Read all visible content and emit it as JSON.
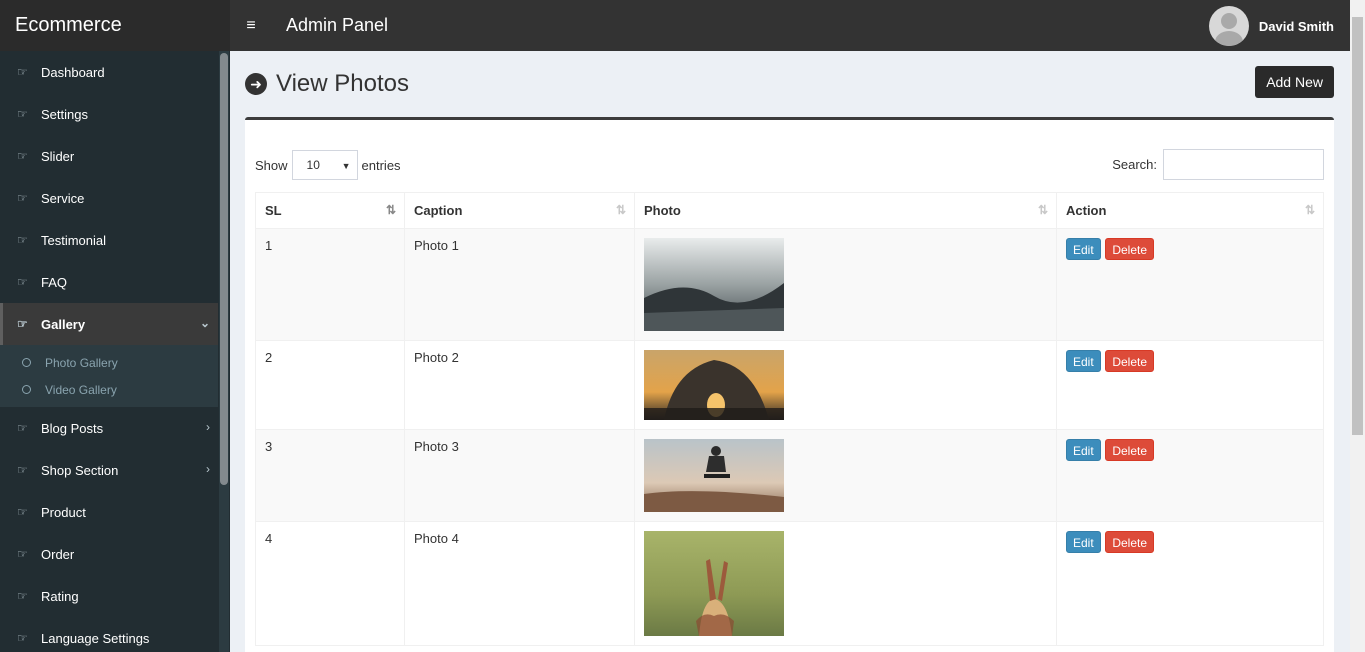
{
  "header": {
    "brand": "Ecommerce",
    "hamburger_icon": "≡",
    "title": "Admin Panel",
    "user_name": "David Smith"
  },
  "sidebar": {
    "items": [
      {
        "label": "Dashboard",
        "icon": "hand-pointer-icon"
      },
      {
        "label": "Settings",
        "icon": "hand-pointer-icon"
      },
      {
        "label": "Slider",
        "icon": "hand-pointer-icon"
      },
      {
        "label": "Service",
        "icon": "hand-pointer-icon"
      },
      {
        "label": "Testimonial",
        "icon": "hand-pointer-icon"
      },
      {
        "label": "FAQ",
        "icon": "hand-pointer-icon"
      },
      {
        "label": "Gallery",
        "icon": "hand-pointer-icon"
      },
      {
        "label": "Blog Posts",
        "icon": "hand-pointer-icon"
      },
      {
        "label": "Shop Section",
        "icon": "hand-pointer-icon"
      },
      {
        "label": "Product",
        "icon": "hand-pointer-icon"
      },
      {
        "label": "Order",
        "icon": "hand-pointer-icon"
      },
      {
        "label": "Rating",
        "icon": "hand-pointer-icon"
      },
      {
        "label": "Language Settings",
        "icon": "hand-pointer-icon"
      }
    ],
    "gallery_sub": [
      "Photo Gallery",
      "Video Gallery"
    ]
  },
  "page": {
    "title": "View Photos",
    "add_button": "Add New"
  },
  "datatable": {
    "show_label": "Show",
    "page_length": "10",
    "entries_label": "entries",
    "search_label": "Search:",
    "search_value": "",
    "columns": [
      "SL",
      "Caption",
      "Photo",
      "Action"
    ],
    "rows": [
      {
        "sl": "1",
        "caption": "Photo 1"
      },
      {
        "sl": "2",
        "caption": "Photo 2"
      },
      {
        "sl": "3",
        "caption": "Photo 3"
      },
      {
        "sl": "4",
        "caption": "Photo 4"
      }
    ],
    "edit_label": "Edit",
    "delete_label": "Delete"
  },
  "colors": {
    "topbar": "#333333",
    "sidebar": "#222d32",
    "edit": "#3c8dbc",
    "delete": "#dd4b39"
  }
}
